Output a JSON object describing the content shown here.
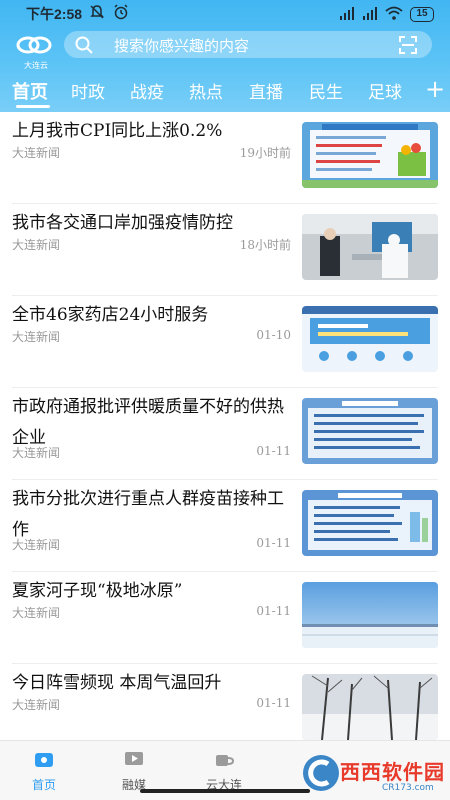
{
  "status_bar": {
    "time": "下午2:58",
    "battery": "15",
    "icons": [
      "mute-icon",
      "alarm-icon",
      "signal-icon",
      "signal-icon",
      "wifi-icon",
      "battery-icon"
    ]
  },
  "header": {
    "logo_text": "大连云",
    "search_placeholder": "搜索你感兴趣的内容",
    "search_icon": "search-icon",
    "scan_icon": "scan-icon",
    "accent_color": "#41b6f2"
  },
  "tabs": [
    {
      "label": "首页",
      "active": true
    },
    {
      "label": "时政"
    },
    {
      "label": "战疫"
    },
    {
      "label": "热点"
    },
    {
      "label": "直播"
    },
    {
      "label": "民生"
    },
    {
      "label": "足球"
    }
  ],
  "tabs_more": "+",
  "news": [
    {
      "title": "上月我市CPI同比上涨0.2%",
      "source": "大连新闻",
      "time": "19小时前"
    },
    {
      "title": "我市各交通口岸加强疫情防控",
      "source": "大连新闻",
      "time": "18小时前"
    },
    {
      "title": "全市46家药店24小时服务",
      "source": "大连新闻",
      "time": "01-10"
    },
    {
      "title": "市政府通报批评供暖质量不好的供热企业",
      "source": "大连新闻",
      "time": "01-11"
    },
    {
      "title": "我市分批次进行重点人群疫苗接种工作",
      "source": "大连新闻",
      "time": "01-11"
    },
    {
      "title": "夏家河子现“极地冰原”",
      "source": "大连新闻",
      "time": "01-11"
    },
    {
      "title": "今日阵雪频现 本周气温回升",
      "source": "大连新闻",
      "time": "01-11"
    }
  ],
  "bottom_nav": [
    {
      "label": "首页",
      "icon": "home-icon",
      "active": true
    },
    {
      "label": "融媒",
      "icon": "media-icon"
    },
    {
      "label": "云大连",
      "icon": "cloud-icon"
    }
  ],
  "watermark": {
    "text": "西西软件园",
    "url": "CR173.com"
  }
}
